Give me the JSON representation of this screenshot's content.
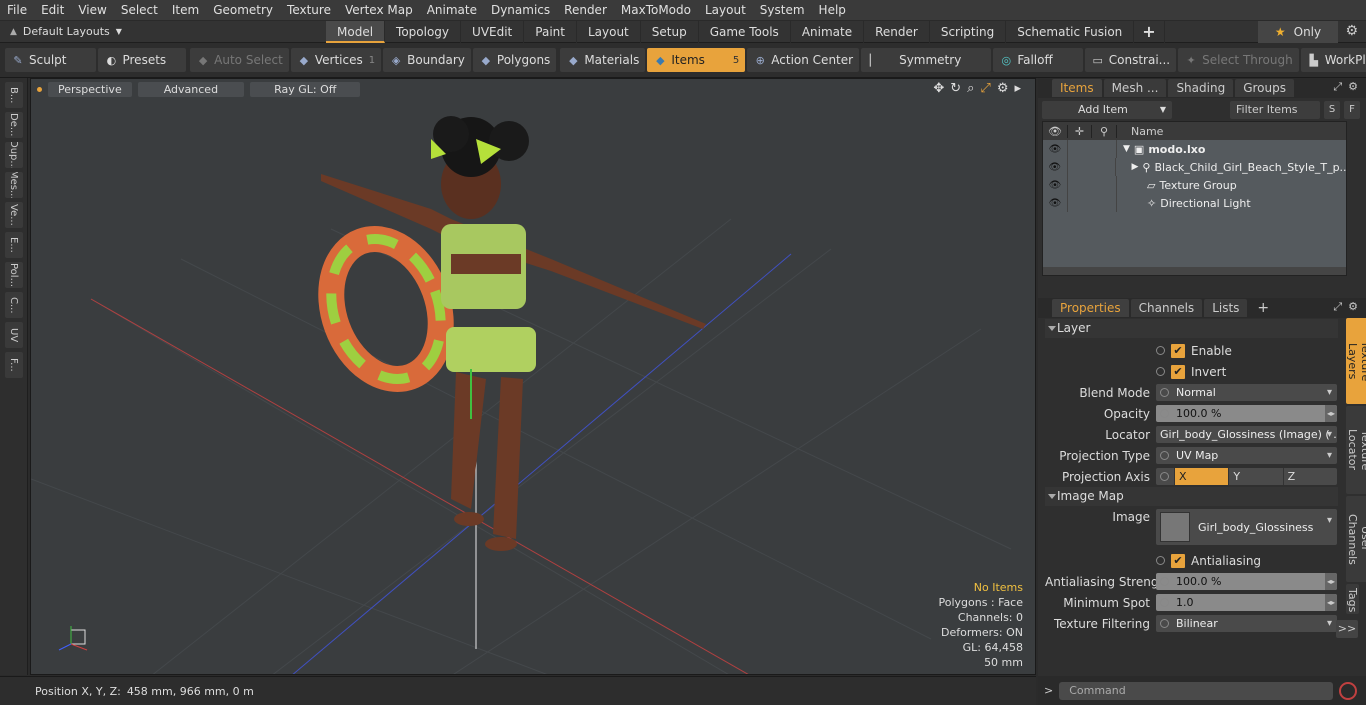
{
  "menu": [
    "File",
    "Edit",
    "View",
    "Select",
    "Item",
    "Geometry",
    "Texture",
    "Vertex Map",
    "Animate",
    "Dynamics",
    "Render",
    "MaxToModo",
    "Layout",
    "System",
    "Help"
  ],
  "layouts": {
    "label": "Default Layouts"
  },
  "tabs": [
    "Model",
    "Topology",
    "UVEdit",
    "Paint",
    "Layout",
    "Setup",
    "Game Tools",
    "Animate",
    "Render",
    "Scripting",
    "Schematic Fusion"
  ],
  "tabs_plus": "+",
  "only_label": "Only",
  "toolbar": {
    "sculpt": "Sculpt",
    "presets": "Presets",
    "auto_select": "Auto Select",
    "vertices": "Vertices",
    "vertices_count": "1",
    "boundary": "Boundary",
    "polygons": "Polygons",
    "materials": "Materials",
    "items": "Items",
    "items_count": "5",
    "action_center": "Action Center",
    "symmetry": "Symmetry",
    "falloff": "Falloff",
    "constraints": "Constrai...",
    "select_through": "Select Through",
    "workplane": "WorkPlane"
  },
  "left_tabs": [
    "B...",
    "De...",
    "Dup...",
    "Mes...",
    "Ve...",
    "E...",
    "Pol...",
    "C...",
    "UV",
    "F..."
  ],
  "viewport": {
    "perspective": "Perspective",
    "advanced": "Advanced",
    "raygl": "Ray GL: Off",
    "stats": {
      "no_items": "No Items",
      "polygons": "Polygons : Face",
      "channels": "Channels: 0",
      "deformers": "Deformers: ON",
      "gl": "GL: 64,458",
      "scale": "50 mm"
    }
  },
  "status": {
    "position_label": "Position X, Y, Z:",
    "position_value": "458 mm, 966 mm, 0 m"
  },
  "items_panel": {
    "tabs": [
      "Items",
      "Mesh ...",
      "Shading",
      "Groups"
    ],
    "add_item": "Add Item",
    "filter": "Filter Items",
    "s": "S",
    "f": "F",
    "name_col": "Name",
    "rows": [
      {
        "label": "modo.lxo"
      },
      {
        "label": "Black_Child_Girl_Beach_Style_T_p..."
      },
      {
        "label": "Texture Group"
      },
      {
        "label": "Directional Light"
      }
    ]
  },
  "props_panel": {
    "tabs": [
      "Properties",
      "Channels",
      "Lists"
    ],
    "layer_section": "Layer",
    "enable": "Enable",
    "invert": "Invert",
    "blend_mode_label": "Blend Mode",
    "blend_mode": "Normal",
    "opacity_label": "Opacity",
    "opacity": "100.0 %",
    "locator_label": "Locator",
    "locator": "Girl_body_Glossiness (Image) ( ...",
    "projection_type_label": "Projection Type",
    "projection_type": "UV Map",
    "projection_axis_label": "Projection Axis",
    "axis": [
      "X",
      "Y",
      "Z"
    ],
    "image_map_section": "Image Map",
    "image_label": "Image",
    "image": "Girl_body_Glossiness",
    "antialiasing": "Antialiasing",
    "aa_strength_label": "Antialiasing Strength",
    "aa_strength": "100.0 %",
    "min_spot_label": "Minimum Spot",
    "min_spot": "1.0",
    "tex_filter_label": "Texture Filtering",
    "tex_filter": "Bilinear",
    "more": ">>"
  },
  "vertical_tabs": [
    "Texture Layers",
    "Texture Locator",
    "User Channels",
    "Tags"
  ],
  "command": {
    "prompt": ">",
    "placeholder": "Command"
  },
  "colors": {
    "accent": "#e8a33c",
    "viewport_bg": "#3a3d3f"
  }
}
